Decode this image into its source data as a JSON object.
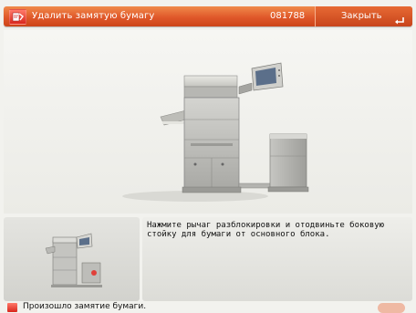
{
  "header": {
    "title": "Удалить замятую бумагу",
    "code": "081788",
    "close_label": "Закрыть",
    "error_icon": "paper-jam-error-icon",
    "close_icon": "enter-return-icon"
  },
  "main": {
    "illustration": "copier-with-side-paper-deck"
  },
  "instruction": {
    "text": "Нажмите рычаг разблокировки и отодвиньте боковую стойку для бумаги от основного блока."
  },
  "status": {
    "text": "Произошло замятие бумаги.",
    "icon": "paper-jam-status-icon"
  },
  "colors": {
    "header_orange": "#e0582a",
    "background": "#f2f2ee"
  }
}
